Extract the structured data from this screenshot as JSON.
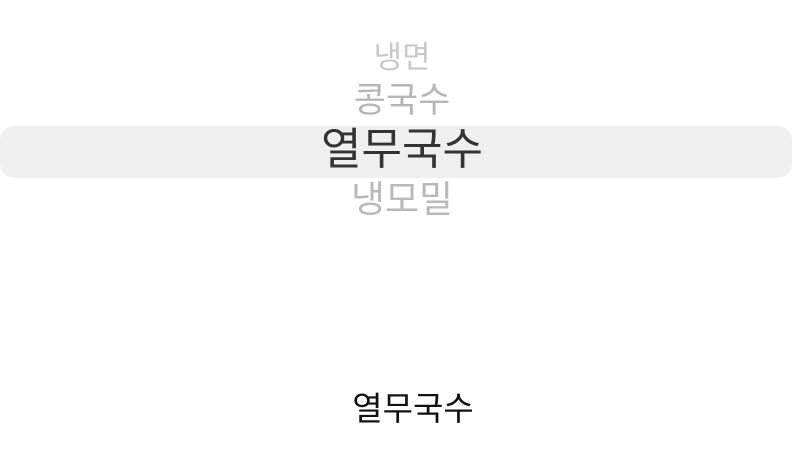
{
  "picker": {
    "items": [
      "냉면",
      "콩국수",
      "열무국수",
      "냉모밀"
    ],
    "selected_index": 2
  },
  "result": {
    "text": "열무국수"
  }
}
